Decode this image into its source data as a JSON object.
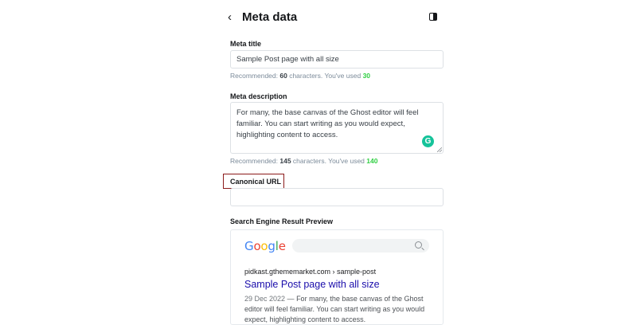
{
  "header": {
    "back_icon": "‹",
    "title": "Meta data",
    "toggle_icon": "sidebar-toggle-icon"
  },
  "meta_title": {
    "label": "Meta title",
    "value": "Sample Post page with all size",
    "hint_prefix": "Recommended: ",
    "recommended": "60",
    "hint_middle": " characters. You've used ",
    "used": "30"
  },
  "meta_description": {
    "label": "Meta description",
    "value": "For many, the base canvas of the Ghost editor will feel familiar. You can start writing as you would expect, highlighting content to access.",
    "hint_prefix": "Recommended: ",
    "recommended": "145",
    "hint_middle": " characters. You've used ",
    "used": "140"
  },
  "canonical_url": {
    "label": "Canonical URL",
    "value": ""
  },
  "serp_preview": {
    "label": "Search Engine Result Preview",
    "logo_letters": [
      "G",
      "o",
      "o",
      "g",
      "l",
      "e"
    ],
    "url": "pidkast.gthememarket.com › sample-post",
    "title": "Sample Post page with all size",
    "date": "29 Dec 2022",
    "separator": " — ",
    "description": "For many, the base canvas of the Ghost editor will feel familiar. You can start writing as you would expect, highlighting content to access."
  },
  "colors": {
    "link_title": "#1a0dab",
    "used_count": "#30cf43",
    "highlight_border": "#8b1a1a",
    "grammarly": "#15c39a"
  }
}
